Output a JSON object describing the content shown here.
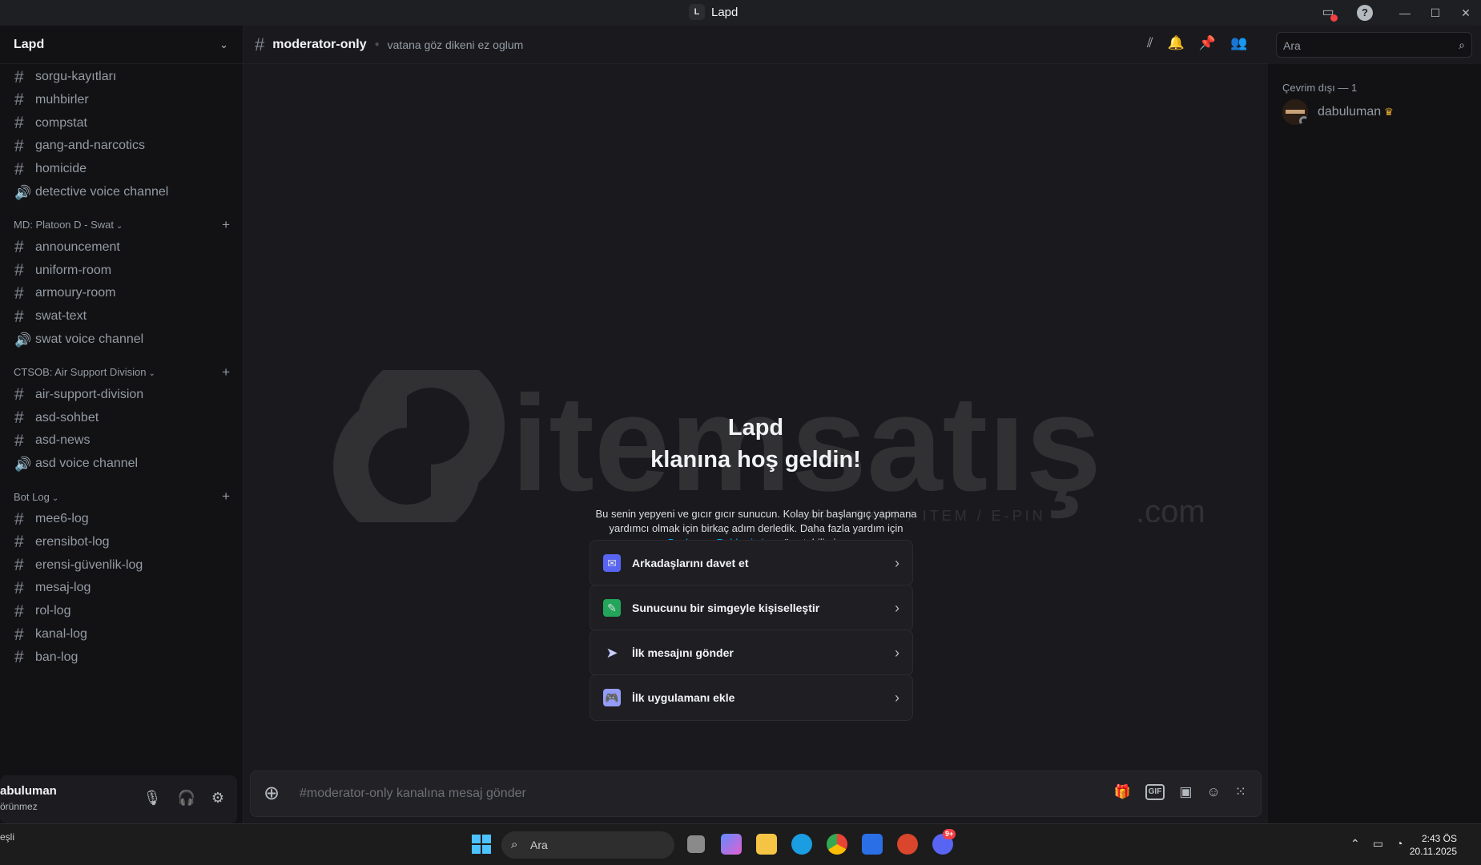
{
  "window": {
    "title": "Lapd",
    "icon_letter": "L"
  },
  "server": {
    "name": "Lapd"
  },
  "channels": {
    "top": [
      {
        "label": "sorgu-kayıtları",
        "type": "text"
      },
      {
        "label": "muhbirler",
        "type": "text"
      },
      {
        "label": "compstat",
        "type": "text"
      },
      {
        "label": "gang-and-narcotics",
        "type": "text"
      },
      {
        "label": "homicide",
        "type": "text"
      },
      {
        "label": "detective voice channel",
        "type": "voice"
      }
    ],
    "categories": [
      {
        "label": "MD: Platoon D - Swat",
        "items": [
          {
            "label": "announcement",
            "type": "text"
          },
          {
            "label": "uniform-room",
            "type": "text"
          },
          {
            "label": "armoury-room",
            "type": "text"
          },
          {
            "label": "swat-text",
            "type": "text"
          },
          {
            "label": "swat voice channel",
            "type": "voice"
          }
        ]
      },
      {
        "label": "CTSOB: Air Support Division",
        "items": [
          {
            "label": "air-support-division",
            "type": "text"
          },
          {
            "label": "asd-sohbet",
            "type": "text"
          },
          {
            "label": "asd-news",
            "type": "text"
          },
          {
            "label": "asd voice channel",
            "type": "voice"
          }
        ]
      },
      {
        "label": "Bot Log",
        "items": [
          {
            "label": "mee6-log",
            "type": "text"
          },
          {
            "label": "erensibot-log",
            "type": "text"
          },
          {
            "label": "erensi-güvenlik-log",
            "type": "text"
          },
          {
            "label": "mesaj-log",
            "type": "text"
          },
          {
            "label": "rol-log",
            "type": "text"
          },
          {
            "label": "kanal-log",
            "type": "text"
          },
          {
            "label": "ban-log",
            "type": "text"
          }
        ]
      }
    ]
  },
  "user": {
    "name": "abuluman",
    "status": "örünmez"
  },
  "channel": {
    "name": "moderator-only",
    "topic": "vatana göz dikeni ez oglum"
  },
  "search": {
    "placeholder": "Ara"
  },
  "welcome": {
    "title_line1": "Lapd",
    "title_line2": "klanına hoş geldin!",
    "desc_part1": "Bu senin yepyeni ve gıcır gıcır sunucun. Kolay bir başlangıç yapmana yardımcı olmak için birkaç adım derledik. Daha fazla yardım için",
    "desc_link": "Başlangıç Rehberimize",
    "desc_part2": "göz atabilirsin.",
    "cards": [
      {
        "label": "Arkadaşlarını davet et",
        "icon": "invite-icon",
        "color": "#5865f2"
      },
      {
        "label": "Sunucunu bir simgeyle kişiselleştir",
        "icon": "customize-icon",
        "color": "#23a55a"
      },
      {
        "label": "İlk mesajını gönder",
        "icon": "paper-plane-icon",
        "color": "#c9cdfb"
      },
      {
        "label": "İlk uygulamanı ekle",
        "icon": "gamepad-icon",
        "color": "#949cf7"
      }
    ]
  },
  "watermark": {
    "brand": "itemsatış",
    "suffix": ".com",
    "tagline": "AP / SKIN / ITEM / E-PIN"
  },
  "composer": {
    "placeholder": "#moderator-only kanalına mesaj gönder"
  },
  "members": {
    "category": "Çevrim dışı — 1",
    "list": [
      {
        "name": "dabuluman",
        "owner": true
      }
    ]
  },
  "taskbar": {
    "left_line1": "",
    "left_line2": "eşli",
    "search": "Ara",
    "time": "2:43 ÖS",
    "date": "20.11.2025",
    "discord_badge": "9+"
  },
  "colors": {
    "accent": "#5865f2",
    "link": "#00a8fc",
    "danger": "#f23f43"
  }
}
